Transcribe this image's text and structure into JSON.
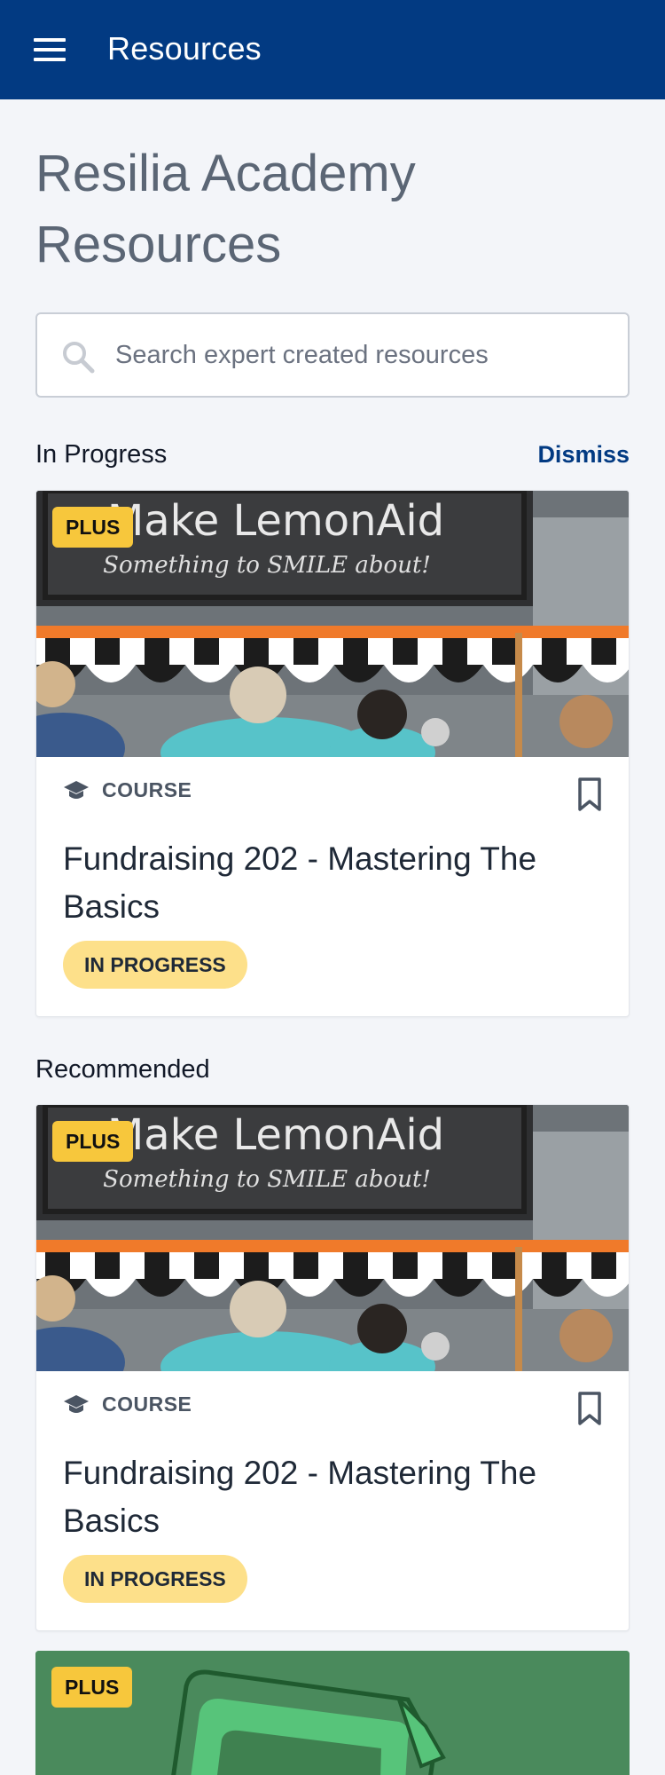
{
  "header": {
    "title": "Resources"
  },
  "page": {
    "title": "Resilia Academy Resources"
  },
  "search": {
    "placeholder": "Search expert created resources"
  },
  "sections": {
    "in_progress": {
      "label": "In Progress",
      "dismiss_label": "Dismiss"
    },
    "recommended": {
      "label": "Recommended"
    }
  },
  "cards": [
    {
      "badge": "PLUS",
      "image_text": {
        "headline": "Make LemonAid",
        "subline": "Something to SMILE about!"
      },
      "type_label": "COURSE",
      "title": "Fundraising 202 - Mastering The Basics",
      "status": "IN PROGRESS"
    },
    {
      "badge": "PLUS",
      "image_text": {
        "headline": "Make LemonAid",
        "subline": "Something to SMILE about!"
      },
      "type_label": "COURSE",
      "title": "Fundraising 202 - Mastering The Basics",
      "status": "IN PROGRESS"
    },
    {
      "badge": "PLUS"
    }
  ],
  "icons": {
    "menu": "hamburger-menu-icon",
    "search": "search-icon",
    "course": "graduation-cap-icon",
    "bookmark": "bookmark-icon"
  },
  "colors": {
    "header_bg": "#023a82",
    "badge_bg": "#f7c73c",
    "status_bg": "#fde08a",
    "page_bg": "#f3f5f9",
    "link": "#023a82"
  }
}
